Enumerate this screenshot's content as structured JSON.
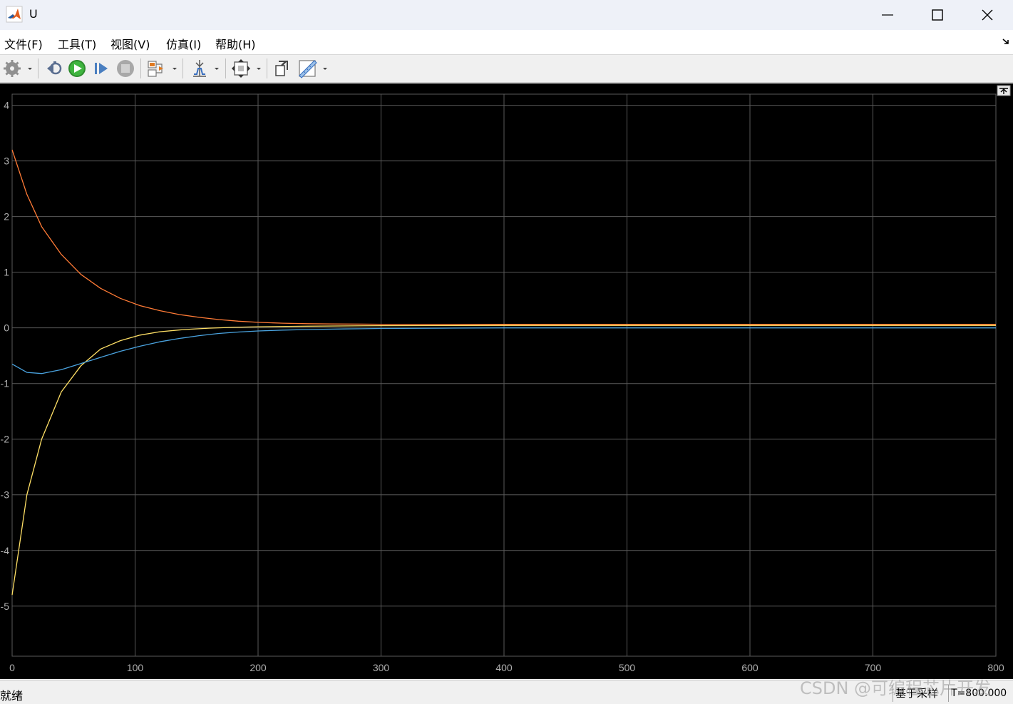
{
  "window": {
    "title": "U",
    "controls": [
      "minimize-icon",
      "maximize-icon",
      "close-icon"
    ]
  },
  "menu": {
    "items": [
      {
        "label": "文件(F)"
      },
      {
        "label": "工具(T)"
      },
      {
        "label": "视图(V)"
      },
      {
        "label": "仿真(I)"
      },
      {
        "label": "帮助(H)"
      }
    ]
  },
  "toolbar": {
    "icons": [
      "settings-gear-icon",
      "step-back-icon",
      "run-icon",
      "step-forward-icon",
      "stop-icon",
      "highlight-block-icon",
      "triggers-icon",
      "autoscale-icon",
      "restore-layout-icon",
      "cursor-measurements-icon"
    ]
  },
  "chart_data": {
    "type": "line",
    "title": "",
    "xlabel": "",
    "ylabel": "",
    "xlim": [
      0,
      800
    ],
    "ylim": [
      -5.9,
      4.2
    ],
    "xticks": [
      0,
      100,
      200,
      300,
      400,
      500,
      600,
      700,
      800
    ],
    "yticks": [
      -5,
      -4,
      -3,
      -2,
      -1,
      0,
      1,
      2,
      3,
      4
    ],
    "grid": true,
    "background": "#000000",
    "grid_color": "#5a5a5a",
    "tick_label_color": "#b0b0b0",
    "series": [
      {
        "color": "#ff7b36",
        "points": [
          [
            0,
            3.2
          ],
          [
            12,
            2.4
          ],
          [
            24,
            1.82
          ],
          [
            40,
            1.32
          ],
          [
            56,
            0.96
          ],
          [
            72,
            0.71
          ],
          [
            88,
            0.53
          ],
          [
            104,
            0.4
          ],
          [
            120,
            0.31
          ],
          [
            136,
            0.24
          ],
          [
            152,
            0.19
          ],
          [
            168,
            0.15
          ],
          [
            184,
            0.12
          ],
          [
            200,
            0.1
          ],
          [
            220,
            0.085
          ],
          [
            240,
            0.075
          ],
          [
            260,
            0.07
          ],
          [
            300,
            0.065
          ],
          [
            400,
            0.063
          ],
          [
            500,
            0.063
          ],
          [
            600,
            0.063
          ],
          [
            700,
            0.063
          ],
          [
            800,
            0.063
          ]
        ]
      },
      {
        "color": "#ffe066",
        "points": [
          [
            0,
            -4.8
          ],
          [
            12,
            -3.0
          ],
          [
            24,
            -2.0
          ],
          [
            40,
            -1.15
          ],
          [
            56,
            -0.68
          ],
          [
            72,
            -0.38
          ],
          [
            88,
            -0.23
          ],
          [
            104,
            -0.13
          ],
          [
            120,
            -0.07
          ],
          [
            140,
            -0.03
          ],
          [
            160,
            -0.005
          ],
          [
            180,
            0.01
          ],
          [
            200,
            0.02
          ],
          [
            240,
            0.03
          ],
          [
            300,
            0.04
          ],
          [
            400,
            0.045
          ],
          [
            500,
            0.045
          ],
          [
            600,
            0.045
          ],
          [
            700,
            0.045
          ],
          [
            800,
            0.045
          ]
        ]
      },
      {
        "color": "#4aa3df",
        "points": [
          [
            0,
            -0.65
          ],
          [
            12,
            -0.8
          ],
          [
            24,
            -0.82
          ],
          [
            40,
            -0.75
          ],
          [
            56,
            -0.64
          ],
          [
            72,
            -0.53
          ],
          [
            88,
            -0.42
          ],
          [
            104,
            -0.33
          ],
          [
            120,
            -0.25
          ],
          [
            136,
            -0.19
          ],
          [
            152,
            -0.14
          ],
          [
            168,
            -0.1
          ],
          [
            184,
            -0.075
          ],
          [
            200,
            -0.055
          ],
          [
            220,
            -0.04
          ],
          [
            240,
            -0.03
          ],
          [
            270,
            -0.02
          ],
          [
            300,
            -0.01
          ],
          [
            350,
            -0.005
          ],
          [
            400,
            0.0
          ],
          [
            500,
            0.0
          ],
          [
            600,
            0.0
          ],
          [
            700,
            0.0
          ],
          [
            800,
            0.0
          ]
        ]
      }
    ]
  },
  "status": {
    "text": "就绪",
    "mode": "基于采样",
    "time": "T=800.000"
  },
  "watermark": "CSDN @可编程芯片开发"
}
